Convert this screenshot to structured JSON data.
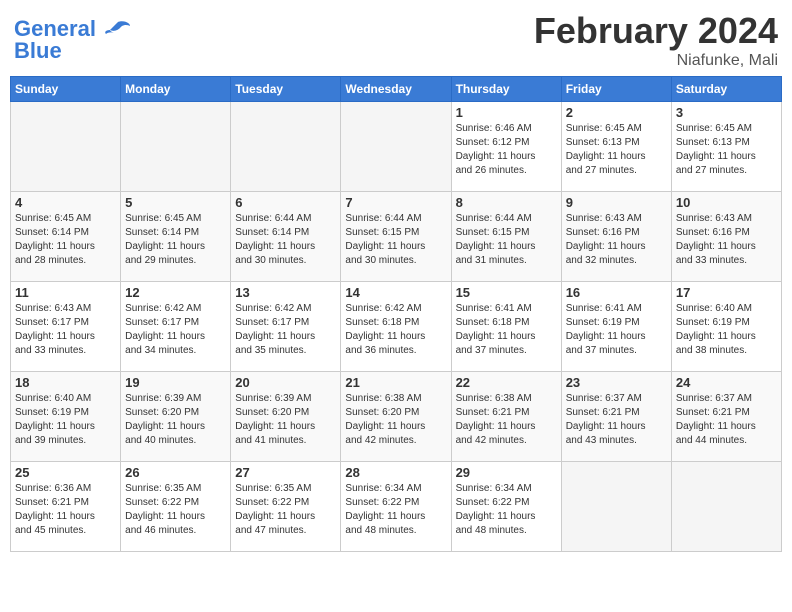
{
  "header": {
    "logo_line1": "General",
    "logo_line2": "Blue",
    "title": "February 2024",
    "subtitle": "Niafunke, Mali"
  },
  "weekdays": [
    "Sunday",
    "Monday",
    "Tuesday",
    "Wednesday",
    "Thursday",
    "Friday",
    "Saturday"
  ],
  "weeks": [
    [
      {
        "day": "",
        "info": ""
      },
      {
        "day": "",
        "info": ""
      },
      {
        "day": "",
        "info": ""
      },
      {
        "day": "",
        "info": ""
      },
      {
        "day": "1",
        "info": "Sunrise: 6:46 AM\nSunset: 6:12 PM\nDaylight: 11 hours\nand 26 minutes."
      },
      {
        "day": "2",
        "info": "Sunrise: 6:45 AM\nSunset: 6:13 PM\nDaylight: 11 hours\nand 27 minutes."
      },
      {
        "day": "3",
        "info": "Sunrise: 6:45 AM\nSunset: 6:13 PM\nDaylight: 11 hours\nand 27 minutes."
      }
    ],
    [
      {
        "day": "4",
        "info": "Sunrise: 6:45 AM\nSunset: 6:14 PM\nDaylight: 11 hours\nand 28 minutes."
      },
      {
        "day": "5",
        "info": "Sunrise: 6:45 AM\nSunset: 6:14 PM\nDaylight: 11 hours\nand 29 minutes."
      },
      {
        "day": "6",
        "info": "Sunrise: 6:44 AM\nSunset: 6:14 PM\nDaylight: 11 hours\nand 30 minutes."
      },
      {
        "day": "7",
        "info": "Sunrise: 6:44 AM\nSunset: 6:15 PM\nDaylight: 11 hours\nand 30 minutes."
      },
      {
        "day": "8",
        "info": "Sunrise: 6:44 AM\nSunset: 6:15 PM\nDaylight: 11 hours\nand 31 minutes."
      },
      {
        "day": "9",
        "info": "Sunrise: 6:43 AM\nSunset: 6:16 PM\nDaylight: 11 hours\nand 32 minutes."
      },
      {
        "day": "10",
        "info": "Sunrise: 6:43 AM\nSunset: 6:16 PM\nDaylight: 11 hours\nand 33 minutes."
      }
    ],
    [
      {
        "day": "11",
        "info": "Sunrise: 6:43 AM\nSunset: 6:17 PM\nDaylight: 11 hours\nand 33 minutes."
      },
      {
        "day": "12",
        "info": "Sunrise: 6:42 AM\nSunset: 6:17 PM\nDaylight: 11 hours\nand 34 minutes."
      },
      {
        "day": "13",
        "info": "Sunrise: 6:42 AM\nSunset: 6:17 PM\nDaylight: 11 hours\nand 35 minutes."
      },
      {
        "day": "14",
        "info": "Sunrise: 6:42 AM\nSunset: 6:18 PM\nDaylight: 11 hours\nand 36 minutes."
      },
      {
        "day": "15",
        "info": "Sunrise: 6:41 AM\nSunset: 6:18 PM\nDaylight: 11 hours\nand 37 minutes."
      },
      {
        "day": "16",
        "info": "Sunrise: 6:41 AM\nSunset: 6:19 PM\nDaylight: 11 hours\nand 37 minutes."
      },
      {
        "day": "17",
        "info": "Sunrise: 6:40 AM\nSunset: 6:19 PM\nDaylight: 11 hours\nand 38 minutes."
      }
    ],
    [
      {
        "day": "18",
        "info": "Sunrise: 6:40 AM\nSunset: 6:19 PM\nDaylight: 11 hours\nand 39 minutes."
      },
      {
        "day": "19",
        "info": "Sunrise: 6:39 AM\nSunset: 6:20 PM\nDaylight: 11 hours\nand 40 minutes."
      },
      {
        "day": "20",
        "info": "Sunrise: 6:39 AM\nSunset: 6:20 PM\nDaylight: 11 hours\nand 41 minutes."
      },
      {
        "day": "21",
        "info": "Sunrise: 6:38 AM\nSunset: 6:20 PM\nDaylight: 11 hours\nand 42 minutes."
      },
      {
        "day": "22",
        "info": "Sunrise: 6:38 AM\nSunset: 6:21 PM\nDaylight: 11 hours\nand 42 minutes."
      },
      {
        "day": "23",
        "info": "Sunrise: 6:37 AM\nSunset: 6:21 PM\nDaylight: 11 hours\nand 43 minutes."
      },
      {
        "day": "24",
        "info": "Sunrise: 6:37 AM\nSunset: 6:21 PM\nDaylight: 11 hours\nand 44 minutes."
      }
    ],
    [
      {
        "day": "25",
        "info": "Sunrise: 6:36 AM\nSunset: 6:21 PM\nDaylight: 11 hours\nand 45 minutes."
      },
      {
        "day": "26",
        "info": "Sunrise: 6:35 AM\nSunset: 6:22 PM\nDaylight: 11 hours\nand 46 minutes."
      },
      {
        "day": "27",
        "info": "Sunrise: 6:35 AM\nSunset: 6:22 PM\nDaylight: 11 hours\nand 47 minutes."
      },
      {
        "day": "28",
        "info": "Sunrise: 6:34 AM\nSunset: 6:22 PM\nDaylight: 11 hours\nand 48 minutes."
      },
      {
        "day": "29",
        "info": "Sunrise: 6:34 AM\nSunset: 6:22 PM\nDaylight: 11 hours\nand 48 minutes."
      },
      {
        "day": "",
        "info": ""
      },
      {
        "day": "",
        "info": ""
      }
    ]
  ]
}
